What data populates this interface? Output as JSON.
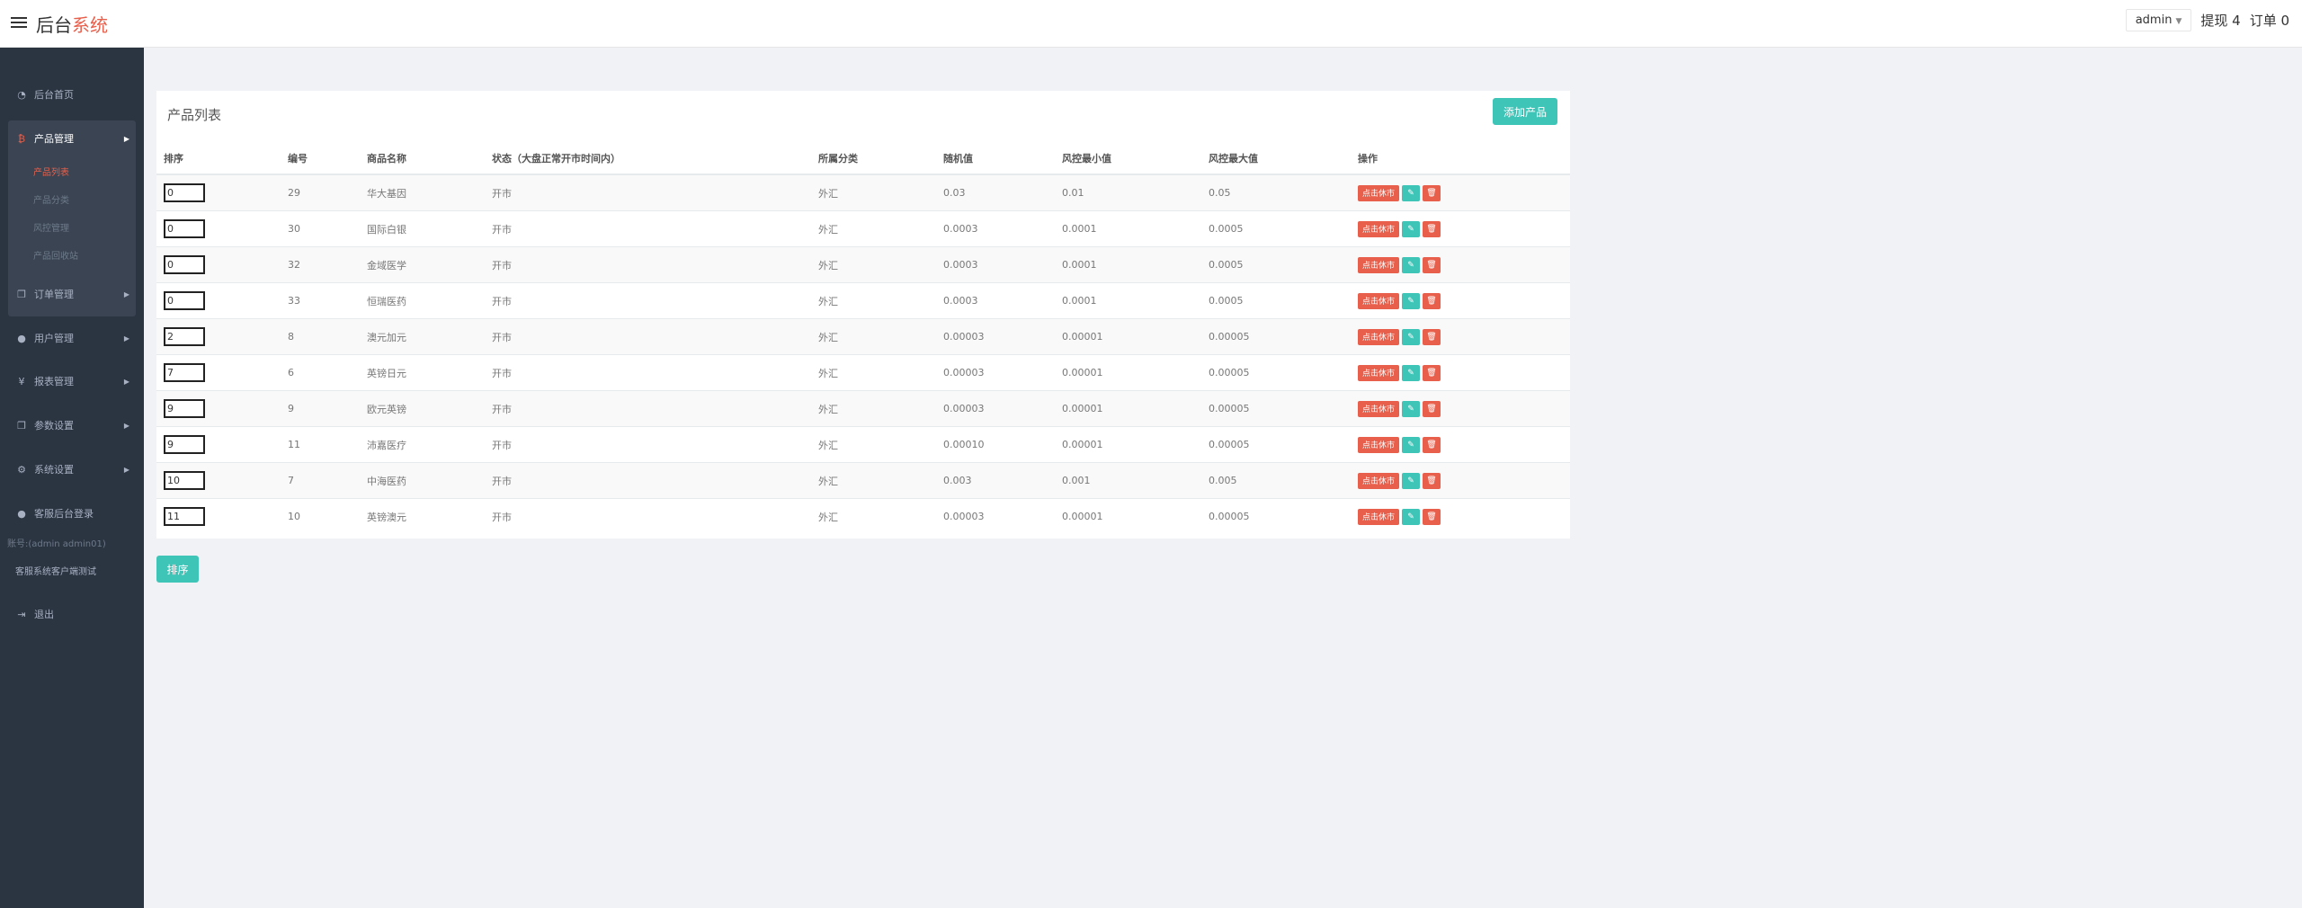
{
  "header": {
    "brand_main": "后台",
    "brand_accent": "系统",
    "admin_label": "admin",
    "withdraw_label": "提现 4",
    "orders_label": "订单 0"
  },
  "sidebar": {
    "home": "后台首页",
    "product_mgmt": "产品管理",
    "product_sub": [
      "产品列表",
      "产品分类",
      "风控管理",
      "产品回收站"
    ],
    "order_mgmt": "订单管理",
    "user_mgmt": "用户管理",
    "report_mgmt": "报表管理",
    "param_settings": "参数设置",
    "system_settings": "系统设置",
    "cs_login": "客服后台登录",
    "account": "账号:(admin admin01)",
    "cs_test": "客服系统客户端测试",
    "logout": "退出"
  },
  "panel": {
    "title": "产品列表",
    "add_button": "添加产品"
  },
  "table": {
    "headers": [
      "排序",
      "编号",
      "商品名称",
      "状态（大盘正常开市时间内）",
      "所属分类",
      "随机值",
      "风控最小值",
      "风控最大值",
      "操作"
    ],
    "rows": [
      {
        "sort": "0",
        "id": "29",
        "name": "华大基因",
        "status": "开市",
        "category": "外汇",
        "random": "0.03",
        "min": "0.01",
        "max": "0.05"
      },
      {
        "sort": "0",
        "id": "30",
        "name": "国际白银",
        "status": "开市",
        "category": "外汇",
        "random": "0.0003",
        "min": "0.0001",
        "max": "0.0005"
      },
      {
        "sort": "0",
        "id": "32",
        "name": "金域医学",
        "status": "开市",
        "category": "外汇",
        "random": "0.0003",
        "min": "0.0001",
        "max": "0.0005"
      },
      {
        "sort": "0",
        "id": "33",
        "name": "恒瑞医药",
        "status": "开市",
        "category": "外汇",
        "random": "0.0003",
        "min": "0.0001",
        "max": "0.0005"
      },
      {
        "sort": "2",
        "id": "8",
        "name": "澳元加元",
        "status": "开市",
        "category": "外汇",
        "random": "0.00003",
        "min": "0.00001",
        "max": "0.00005"
      },
      {
        "sort": "7",
        "id": "6",
        "name": "英镑日元",
        "status": "开市",
        "category": "外汇",
        "random": "0.00003",
        "min": "0.00001",
        "max": "0.00005"
      },
      {
        "sort": "9",
        "id": "9",
        "name": "欧元英镑",
        "status": "开市",
        "category": "外汇",
        "random": "0.00003",
        "min": "0.00001",
        "max": "0.00005"
      },
      {
        "sort": "9",
        "id": "11",
        "name": "沛嘉医疗",
        "status": "开市",
        "category": "外汇",
        "random": "0.00010",
        "min": "0.00001",
        "max": "0.00005"
      },
      {
        "sort": "10",
        "id": "7",
        "name": "中海医药",
        "status": "开市",
        "category": "外汇",
        "random": "0.003",
        "min": "0.001",
        "max": "0.005"
      },
      {
        "sort": "11",
        "id": "10",
        "name": "英镑澳元",
        "status": "开市",
        "category": "外汇",
        "random": "0.00003",
        "min": "0.00001",
        "max": "0.00005"
      }
    ],
    "close_label": "点击休市",
    "edit_glyph": "✎",
    "delete_glyph": "🗑"
  },
  "sort_button": "排序",
  "colors": {
    "accent_red": "#e8604c",
    "accent_teal": "#3fc5b8",
    "sidebar_bg": "#2b3441"
  }
}
